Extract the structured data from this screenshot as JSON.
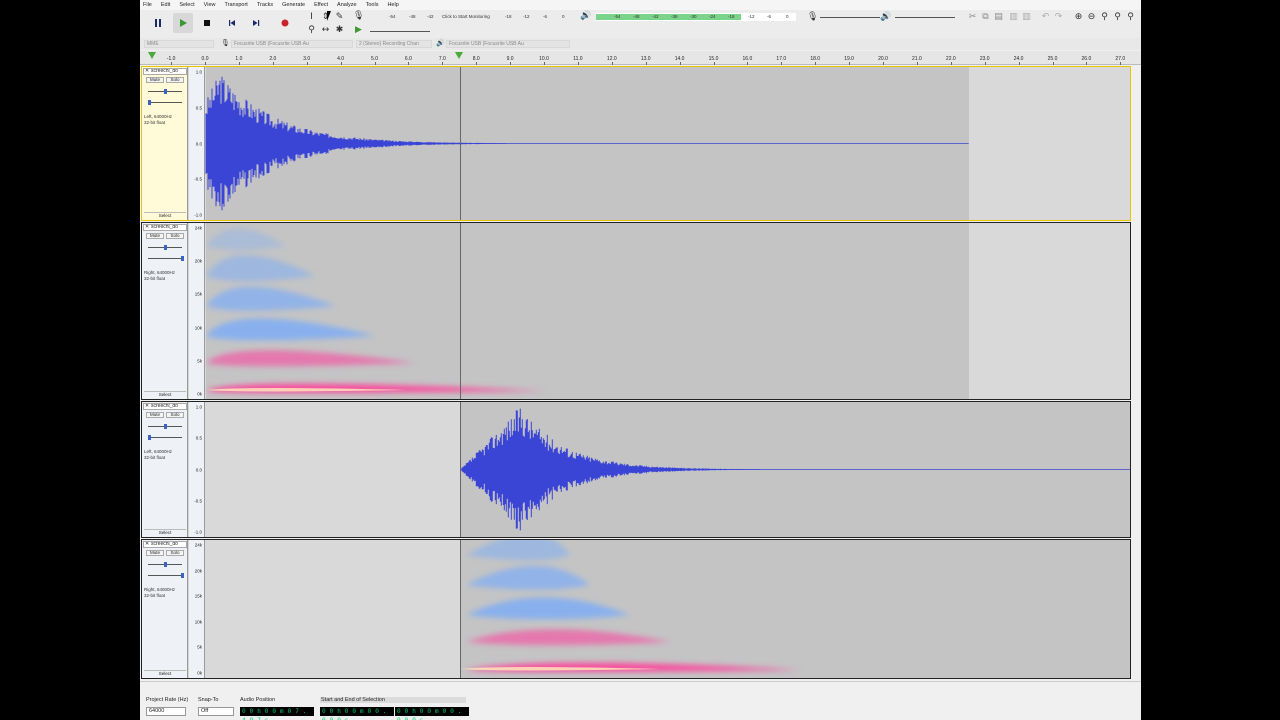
{
  "menu": [
    "File",
    "Edit",
    "Select",
    "View",
    "Transport",
    "Tracks",
    "Generate",
    "Effect",
    "Analyze",
    "Tools",
    "Help"
  ],
  "transport": {
    "pause": "pause-icon",
    "play": "play-icon",
    "stop": "stop-icon",
    "skip_start": "skip-start-icon",
    "skip_end": "skip-end-icon",
    "record": "record-icon"
  },
  "meter": {
    "record_ticks": [
      "-54",
      "-48",
      "-42",
      "Click to Start Monitoring",
      "-18",
      "-12",
      "-6",
      "0"
    ],
    "playback_ticks": [
      "-54",
      "-48",
      "-42",
      "-36",
      "-30",
      "-24",
      "-18",
      "-12",
      "-6",
      "0"
    ],
    "rec_label": "R",
    "play_label": "L R"
  },
  "devices": {
    "host": "MME",
    "rec_device": "Focusrite USB (Focusrite USB Au",
    "channels": "2 (Stereo) Recording Chan",
    "play_device": "Focusrite USB (Focusrite USB Au"
  },
  "ruler": {
    "ticks": [
      "-1.0",
      "0.0",
      "1.0",
      "2.0",
      "3.0",
      "4.0",
      "5.0",
      "6.0",
      "7.0",
      "8.0",
      "9.0",
      "10.0",
      "11.0",
      "12.0",
      "13.0",
      "14.0",
      "15.0",
      "16.0",
      "17.0",
      "18.0",
      "19.0",
      "20.0",
      "21.0",
      "22.0",
      "23.0",
      "24.0",
      "25.0",
      "26.0",
      "27.0"
    ]
  },
  "tracks": [
    {
      "name": "screechi_do",
      "mute": "Mute",
      "solo": "Solo",
      "info1": "Left, 64000Hz",
      "info2": "32-bit float",
      "select": "Select",
      "scale": [
        "1.0",
        "0.5",
        "0.0",
        "-0.5",
        "-1.0"
      ],
      "view": "waveform",
      "clip_start": 0.0,
      "clip_end": 22.5,
      "audio_start": 0.0
    },
    {
      "name": "screechi_do",
      "mute": "Mute",
      "solo": "Solo",
      "info1": "Right, 64000Hz",
      "info2": "32-bit float",
      "select": "Select",
      "scale": [
        "24k",
        "20k",
        "15k",
        "10k",
        "5k",
        "0k"
      ],
      "view": "spectrogram",
      "clip_start": 0.0,
      "clip_end": 22.5,
      "audio_start": 0.0
    },
    {
      "name": "screechi_do",
      "mute": "Mute",
      "solo": "Solo",
      "info1": "Left, 64000Hz",
      "info2": "32-bit float",
      "select": "Select",
      "scale": [
        "1.0",
        "0.5",
        "0.0",
        "-0.5",
        "-1.0"
      ],
      "view": "waveform",
      "clip_start": 7.5,
      "clip_end": 27.5,
      "audio_start": 7.5
    },
    {
      "name": "screechi_do",
      "mute": "Mute",
      "solo": "Solo",
      "info1": "Right, 64000Hz",
      "info2": "32-bit float",
      "select": "Select",
      "scale": [
        "24k",
        "20k",
        "15k",
        "10k",
        "5k",
        "0k"
      ],
      "view": "spectrogram",
      "clip_start": 7.5,
      "clip_end": 27.5,
      "audio_start": 7.5
    }
  ],
  "playhead_time": 7.5,
  "status": {
    "project_rate_label": "Project Rate (Hz)",
    "project_rate": "64000",
    "snap_label": "Snap-To",
    "snap": "Off",
    "audio_pos_label": "Audio Position",
    "audio_pos": "0 0 h 0 0 m 0 7 . 4 9 7 s",
    "sel_label": "Start and End of Selection",
    "sel_start": "0 0 h 0 0 m 0 0 . 0 0 0 s",
    "sel_end": "0 0 h 0 0 m 0 0 . 0 0 0 s"
  },
  "colors": {
    "wave": "#3a45d6",
    "spec_blue": "#6fa8ff",
    "spec_pink": "#ff3d9a",
    "selected_border": "#e7c600"
  }
}
